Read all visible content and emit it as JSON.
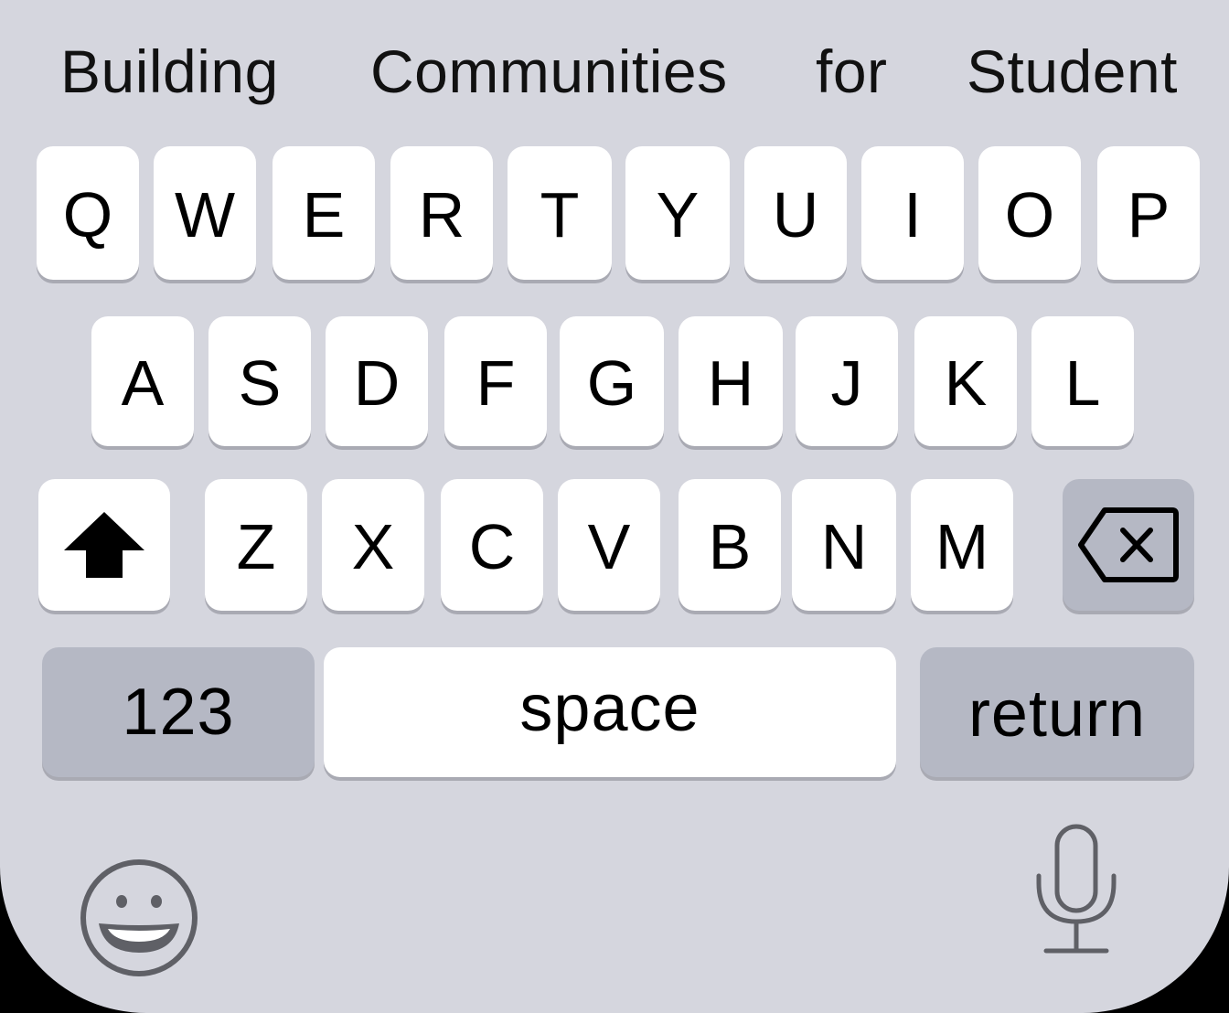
{
  "suggestions": [
    "Building",
    "Communities",
    "for",
    "Student"
  ],
  "rows": [
    [
      "Q",
      "W",
      "E",
      "R",
      "T",
      "Y",
      "U",
      "I",
      "O",
      "P"
    ],
    [
      "A",
      "S",
      "D",
      "F",
      "G",
      "H",
      "J",
      "K",
      "L"
    ],
    [
      "Z",
      "X",
      "C",
      "V",
      "B",
      "N",
      "M"
    ]
  ],
  "keys": {
    "numbers_label": "123",
    "space_label": "space",
    "return_label": "return"
  },
  "icons": {
    "shift": "shift-arrow-icon",
    "backspace": "backspace-icon",
    "emoji": "emoji-smiley-icon",
    "dictation": "microphone-icon"
  },
  "colors": {
    "keyboard_bg": "#d5d6de",
    "key_bg": "#ffffff",
    "special_key_bg": "#b5b8c4",
    "key_shadow": "#a9aab3",
    "icon_gray": "#5f6066"
  }
}
